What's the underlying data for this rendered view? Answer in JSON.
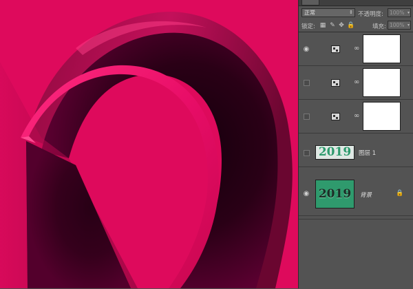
{
  "colors": {
    "canvas_bg": "#de0a5c",
    "ribbon": "#e6106a",
    "shadow": "#1a0010",
    "panel_bg": "#535353",
    "thumb_green": "#2f9a6d"
  },
  "layers_panel": {
    "blend_mode": "正常",
    "opacity_label": "不透明度:",
    "opacity_value": "100%",
    "lock_label": "锁定:",
    "fill_label": "填充:",
    "fill_value": "100%",
    "lock_icons": [
      "lock-transparent-icon",
      "lock-image-icon",
      "lock-position-icon",
      "lock-all-icon"
    ],
    "layers": [
      {
        "name": "",
        "visible": true,
        "type": "adjustment",
        "icon": "adjustment-layer-icon"
      },
      {
        "name": "",
        "visible": false,
        "type": "adjustment",
        "icon": "adjustment-layer-icon"
      },
      {
        "name": "",
        "visible": false,
        "type": "adjustment",
        "icon": "adjustment-layer-icon"
      },
      {
        "name": "图层 1",
        "visible": false,
        "type": "image",
        "thumb_text": "2019"
      },
      {
        "name": "背景",
        "visible": true,
        "type": "background",
        "thumb_text": "2019",
        "locked": true
      }
    ]
  }
}
